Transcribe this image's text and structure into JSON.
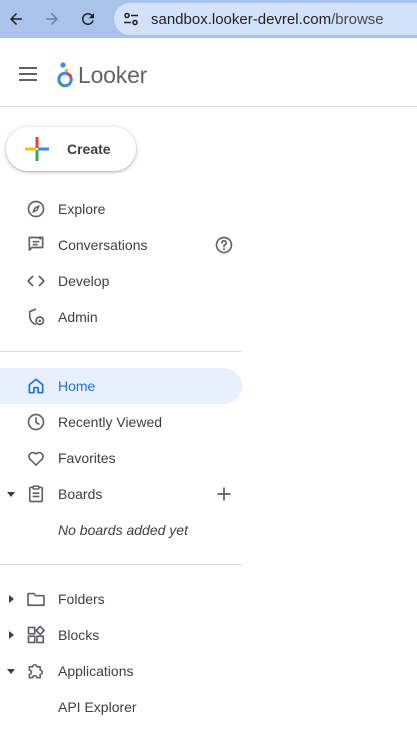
{
  "browser": {
    "url_host": "sandbox.looker-devrel.com",
    "url_path": "/browse",
    "icons": [
      "back-icon",
      "forward-icon",
      "reload-icon",
      "site-info-icon"
    ]
  },
  "header": {
    "brand": "Looker",
    "icons": [
      "hamburger-menu-icon",
      "looker-logo-icon"
    ]
  },
  "create": {
    "label": "Create",
    "icon": "multicolor-plus-icon"
  },
  "nav": {
    "explore": {
      "label": "Explore",
      "icon": "compass-icon"
    },
    "conversations": {
      "label": "Conversations",
      "icon": "conversations-icon",
      "trail_icon": "help-icon"
    },
    "develop": {
      "label": "Develop",
      "icon": "code-icon"
    },
    "admin": {
      "label": "Admin",
      "icon": "admin-gear-icon"
    },
    "home": {
      "label": "Home",
      "icon": "home-icon"
    },
    "recently_viewed": {
      "label": "Recently Viewed",
      "icon": "clock-icon"
    },
    "favorites": {
      "label": "Favorites",
      "icon": "heart-icon"
    },
    "boards": {
      "label": "Boards",
      "icon": "clipboard-icon",
      "trail_icon": "add-icon",
      "empty_text": "No boards added yet"
    },
    "folders": {
      "label": "Folders",
      "icon": "folder-icon"
    },
    "blocks": {
      "label": "Blocks",
      "icon": "blocks-icon"
    },
    "applications": {
      "label": "Applications",
      "icon": "puzzle-icon"
    },
    "api_explorer": {
      "label": "API Explorer"
    }
  },
  "colors": {
    "browser_bar": "#a9c3ea",
    "omnibox": "#d3e2f8",
    "active_bg": "#e8f0fe",
    "active_text": "#1a73e8",
    "icon": "#5f6368",
    "divider": "#dadce0"
  }
}
